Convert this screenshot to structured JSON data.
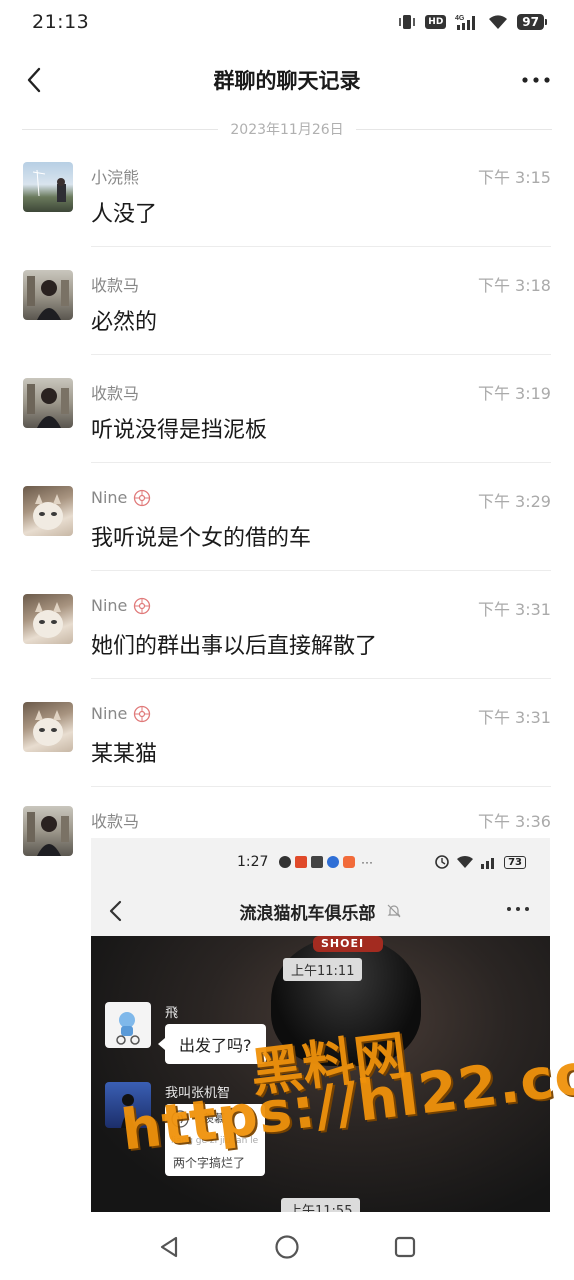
{
  "status_bar": {
    "time": "21:13",
    "network": "4G",
    "hd": "HD",
    "battery": "97"
  },
  "nav": {
    "title": "群聊的聊天记录"
  },
  "date_divider": "2023年11月26日",
  "messages": [
    {
      "sender": "小浣熊",
      "time": "下午 3:15",
      "text": "人没了"
    },
    {
      "sender": "收款马",
      "time": "下午 3:18",
      "text": "必然的"
    },
    {
      "sender": "收款马",
      "time": "下午 3:19",
      "text": "听说没得是挡泥板"
    },
    {
      "sender": "Nine",
      "time": "下午 3:29",
      "text": "我听说是个女的借的车"
    },
    {
      "sender": "Nine",
      "time": "下午 3:31",
      "text": "她们的群出事以后直接解散了"
    },
    {
      "sender": "Nine",
      "time": "下午 3:31",
      "text": "某某猫"
    },
    {
      "sender": "收款马",
      "time": "下午 3:36",
      "text": ""
    }
  ],
  "screenshot": {
    "status_time": "1:27",
    "battery": "73",
    "title": "流浪猫机车俱乐部",
    "helmet_brand": "SHOEI",
    "stamp_1": "上午11:11",
    "stamp_2": "上午11:55",
    "msg1_sender": "飛",
    "msg1_text": "出发了吗?",
    "msg2_sender": "我叫张机智",
    "msg2_voice_text": "羡慕",
    "msg2_pinyin": "liang ge zi jiu lan le",
    "msg2_line": "两个字搞烂了"
  },
  "watermark": {
    "line1": "黑料网",
    "line2": "https://hl22.co"
  }
}
